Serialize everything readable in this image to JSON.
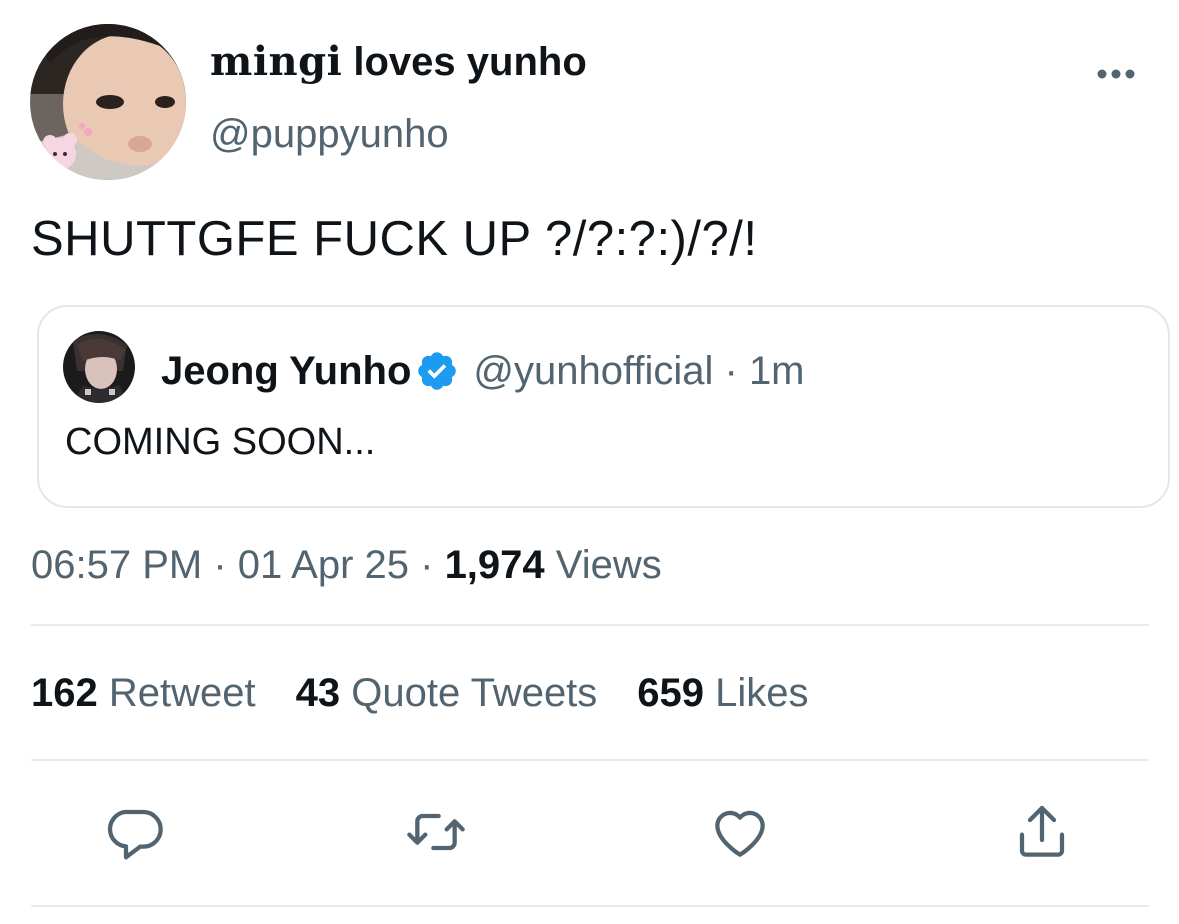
{
  "author": {
    "name_stylized": "mingi",
    "name_rest": " loves yunho",
    "handle": "@puppyunho"
  },
  "tweet": {
    "text": "SHUTTGFE FUCK UP ?/?:?:)/?/!"
  },
  "quoted_tweet": {
    "name": "Jeong Yunho",
    "handle_and_time": "@yunhofficial · 1m",
    "text": "COMING SOON...",
    "verified_icon": "verified-badge-icon"
  },
  "meta": {
    "time_date": "06:57 PM · 01 Apr 25 · ",
    "views_count": "1,974",
    "views_label": " Views"
  },
  "stats": {
    "retweets_count": "162",
    "retweets_label": " Retweet",
    "quotes_count": "43",
    "quotes_label": " Quote Tweets",
    "likes_count": "659",
    "likes_label": " Likes"
  },
  "actions": {
    "reply": "reply-icon",
    "retweet": "retweet-icon",
    "like": "heart-icon",
    "share": "share-icon"
  },
  "colors": {
    "text_primary": "#0f1419",
    "text_secondary": "#536471",
    "verified_blue": "#1d9bf0",
    "border": "#e1e8ed"
  }
}
